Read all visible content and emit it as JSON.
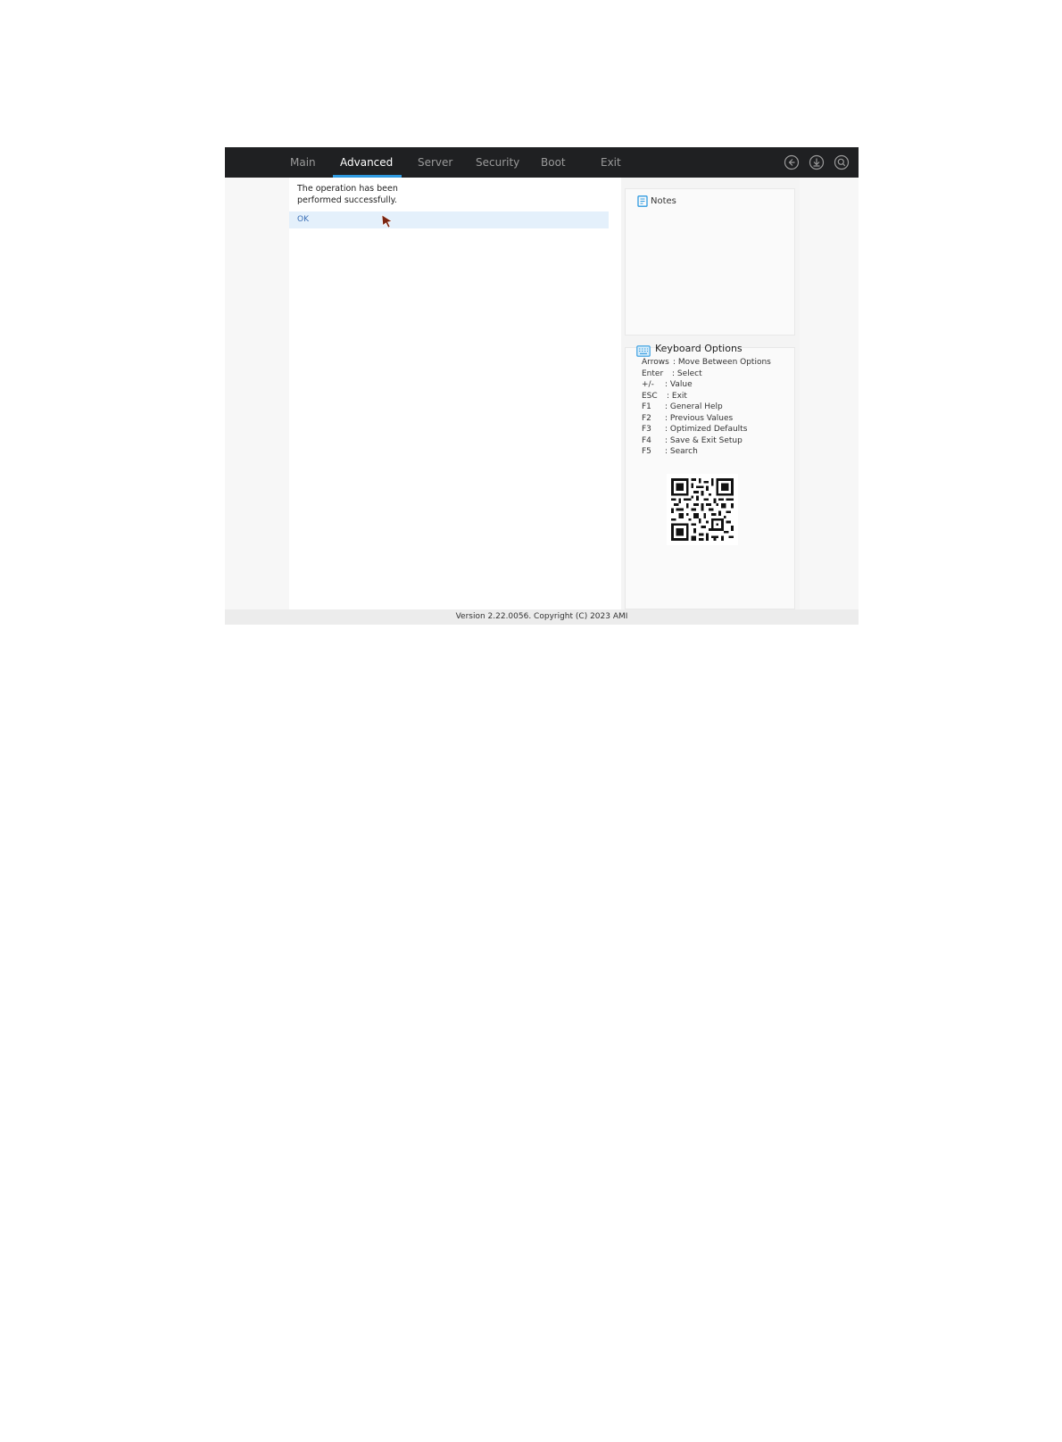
{
  "nav": {
    "tabs": [
      {
        "label": "Main",
        "active": false
      },
      {
        "label": "Advanced",
        "active": true
      },
      {
        "label": "Server",
        "active": false
      },
      {
        "label": "Security",
        "active": false
      },
      {
        "label": "Boot",
        "active": false
      },
      {
        "label": "Exit",
        "active": false
      }
    ],
    "icons": [
      "back-icon",
      "download-icon",
      "search-icon"
    ]
  },
  "dialog": {
    "message_line1": "The operation has been",
    "message_line2": "performed successfully.",
    "ok_label": "OK"
  },
  "notes": {
    "title": "Notes"
  },
  "keyboard": {
    "title": "Keyboard Options",
    "options": [
      {
        "key": "Arrows",
        "desc": ": Move Between Options"
      },
      {
        "key": "Enter",
        "desc": ": Select"
      },
      {
        "key": "+/-",
        "desc": ": Value"
      },
      {
        "key": "ESC",
        "desc": ": Exit"
      },
      {
        "key": "F1",
        "desc": ": General Help"
      },
      {
        "key": "F2",
        "desc": ": Previous Values"
      },
      {
        "key": "F3",
        "desc": ": Optimized Defaults"
      },
      {
        "key": "F4",
        "desc": ": Save & Exit Setup"
      },
      {
        "key": "F5",
        "desc": ": Search"
      }
    ]
  },
  "footer": {
    "text": "Version 2.22.0056. Copyright (C) 2023 AMI"
  },
  "colors": {
    "topbar": "#1f2022",
    "accent": "#2f9ae0",
    "highlight": "#e4f0fb"
  }
}
